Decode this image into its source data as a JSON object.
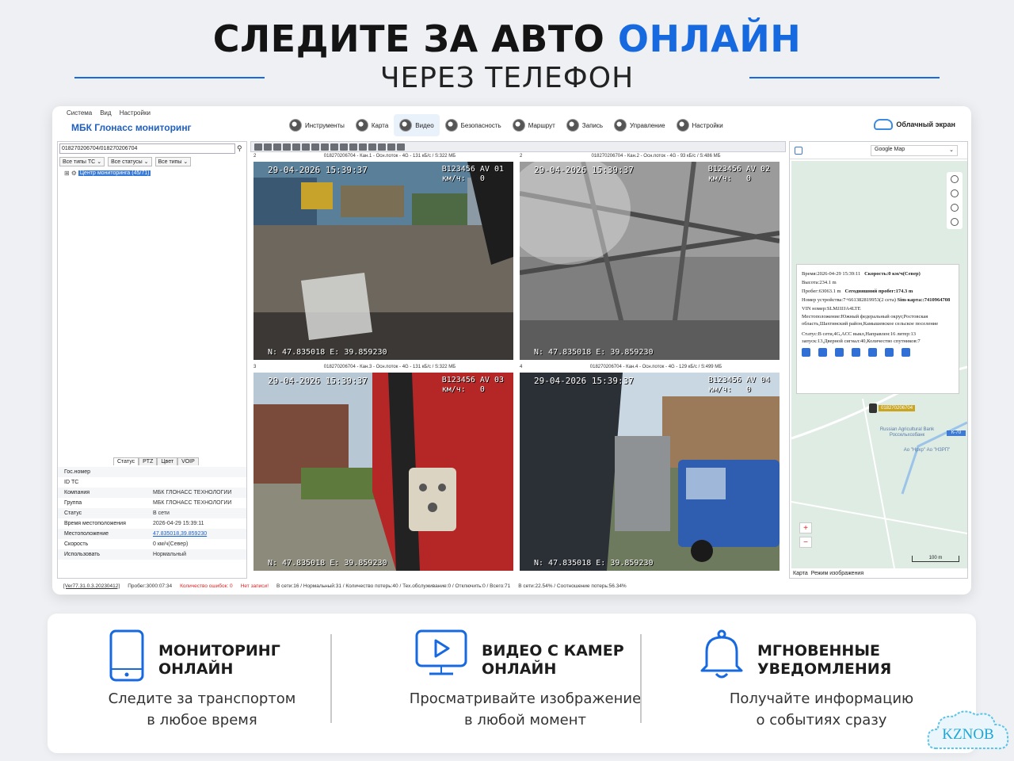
{
  "hero": {
    "title_main": "СЛЕДИТЕ ЗА АВТО",
    "title_accent": "ОНЛАЙН",
    "subtitle": "ЧЕРЕЗ ТЕЛЕФОН"
  },
  "app": {
    "menu": [
      "Система",
      "Вид",
      "Настройки"
    ],
    "brand": "МБК Глонасс мониторинг",
    "toolbar": [
      {
        "label": "Инструменты",
        "icon": "tools-icon",
        "active": false
      },
      {
        "label": "Карта",
        "icon": "map-icon",
        "active": false
      },
      {
        "label": "Видео",
        "icon": "video-icon",
        "active": true
      },
      {
        "label": "Безопасность",
        "icon": "shield-icon",
        "active": false
      },
      {
        "label": "Маршрут",
        "icon": "route-icon",
        "active": false
      },
      {
        "label": "Запись",
        "icon": "record-icon",
        "active": false
      },
      {
        "label": "Управление",
        "icon": "control-icon",
        "active": false
      },
      {
        "label": "Настройки",
        "icon": "gear-icon",
        "active": false
      }
    ],
    "cloud_label": "Облачный экран",
    "search_value": "018270206704/018270206704",
    "filters": [
      "Все типы ТС",
      "Все статусы",
      "Все типы"
    ],
    "tree_label": "Центр мониторинга (45/71)",
    "tabs": [
      "Статус",
      "PTZ",
      "Цвет",
      "VOIP"
    ],
    "properties": [
      {
        "key": "Гос.номер",
        "value": ""
      },
      {
        "key": "ID ТС",
        "value": ""
      },
      {
        "key": "Компания",
        "value": "МБК ГЛОНАСС ТЕХНОЛОГИИ"
      },
      {
        "key": "Группа",
        "value": "МБК ГЛОНАСС ТЕХНОЛОГИИ"
      },
      {
        "key": "Статус",
        "value": "В сети"
      },
      {
        "key": "Время местоположения",
        "value": "2026-04-29 15:39:11"
      },
      {
        "key": "Местоположение",
        "value": "47.835018,39.859230"
      },
      {
        "key": "Скорость",
        "value": "0 км/ч(Север)"
      },
      {
        "key": "Использовать",
        "value": "Нормальный"
      }
    ],
    "cameras": [
      {
        "num": "2",
        "info": "018270206704 - Кан.1 - Осн.поток - 4G - 131 кБ/с / S:322 МБ",
        "timestamp": "29-04-2026 15:39:37",
        "plate": "B123456 AV 01",
        "speed_label": "км/ч:",
        "speed": "0",
        "gps": "N: 47.835018 E: 39.859230"
      },
      {
        "num": "2",
        "info": "018270206704 - Кан.2 - Осн.поток - 4G - 93 кБ/с / S:486 МБ",
        "timestamp": "29-04-2026 15:39:37",
        "plate": "B123456 AV 02",
        "speed_label": "км/ч:",
        "speed": "0",
        "gps": "N: 47.835018 E: 39.859230"
      },
      {
        "num": "3",
        "info": "018270206704 - Кан.3 - Осн.поток - 4G - 131 кБ/с / S:322 МБ",
        "timestamp": "29-04-2026 15:39:37",
        "plate": "B123456 AV 03",
        "speed_label": "км/ч:",
        "speed": "0",
        "gps": "N: 47.835018 E: 39.859230"
      },
      {
        "num": "4",
        "info": "018270206704 - Кан.4 - Осн.поток - 4G - 129 кБ/с / S:499 МБ",
        "timestamp": "29-04-2026 15:39:37",
        "plate": "B123456 AV 04",
        "speed_label": "км/ч:",
        "speed": "0",
        "gps": "N: 47.835018 E: 39.859230"
      }
    ],
    "map": {
      "provider": "Google Map",
      "popup": {
        "time": "Время:2026-04-29 15:39:11",
        "speed": "Скорость:0 км/ч(Север)",
        "altitude": "Высота:234.1 m",
        "mileage": "Пробег:63063.1 m",
        "today_mileage": "Сегодняшний пробег:174.3 m",
        "device": "Номер устройства:7+661382819953(2 сета)",
        "sim": "Sim-карта::7410964708",
        "vin": "VIN номер:SLMJJJJA4LTE",
        "location": "Местоположение:Южный федеральный округ,Ростовская область,Шахтинский район,Камышевское сельское поселение",
        "status": "Статус:В сети,4G,ACC выкл,Направлен:16 литер:13 запуск:13,Дверной сигнал:40,Количество спутников:7"
      },
      "vehicle_tag": "018270206704",
      "poi_bank": "Russian Agricultural Bank",
      "poi_bank_sub": "Россельхозбанк",
      "poi_other": "Ао \"Нрхр\" Ао \"НЗРП\"",
      "road": "К-70",
      "scale": "100 m",
      "tabs": [
        "Карта",
        "Режим изображения"
      ]
    },
    "status_bar": {
      "version": "[Ver77.31.0.3.20230412]",
      "mileage": "Пробег:3000:07:34",
      "errors": "Количество ошибок: 0",
      "no_record": "Нет записи!",
      "stats": "В сети:16 / Нормальный:31 / Количество потерь:40 / Тех.обслуживание:0 / Отключить:0 / Всего:71",
      "ratio": "В сети:22.54% / Соотношение потерь:56.34%"
    }
  },
  "features": [
    {
      "icon": "phone-icon",
      "title_line1": "МОНИТОРИНГ",
      "title_line2": "ОНЛАЙН",
      "desc_line1": "Следите за транспортом",
      "desc_line2": "в любое время"
    },
    {
      "icon": "video-play-icon",
      "title_line1": "ВИДЕО С КАМЕР",
      "title_line2": "ОНЛАЙН",
      "desc_line1": "Просматривайте изображение",
      "desc_line2": "в любой момент"
    },
    {
      "icon": "bell-icon",
      "title_line1": "МГНОВЕННЫЕ",
      "title_line2": "УВЕДОМЛЕНИЯ",
      "desc_line1": "Получайте информацию",
      "desc_line2": "о событиях сразу"
    }
  ],
  "watermark": "KZNOB",
  "colors": {
    "accent": "#1769e0",
    "text": "#141414",
    "link": "#1a5fcc",
    "alert": "#e02020"
  }
}
